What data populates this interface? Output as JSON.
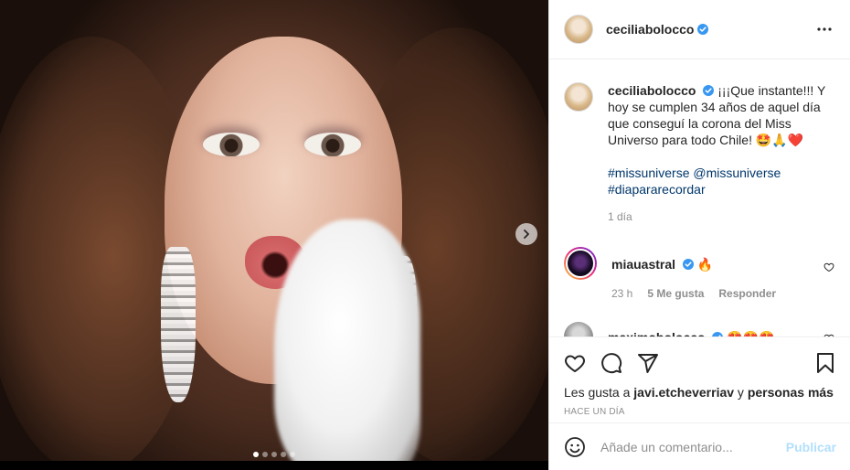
{
  "post": {
    "username": "ceciliabolocco",
    "caption": "¡¡¡Que instante!!! Y hoy se cumplen 34 años de aquel día que conseguí la corona del Miss Universo para todo Chile! 🤩🙏❤️",
    "hashtags": "#missuniverse @missuniverse #diapararecordar",
    "caption_time": "1 día"
  },
  "carousel": {
    "total": 5,
    "current": 1
  },
  "comments": [
    {
      "username": "miauastral",
      "text": "🔥",
      "time": "23 h",
      "likes": "5 Me gusta",
      "reply": "Responder"
    },
    {
      "username": "maximobolocco",
      "text": "😍😍😍"
    }
  ],
  "likes_line": {
    "prefix": "Les gusta a",
    "user": "javi.etcheverriav",
    "joiner": "y",
    "others": "personas más"
  },
  "posted_ago": "HACE UN DÍA",
  "composer": {
    "placeholder": "Añade un comentario...",
    "publish": "Publicar"
  },
  "colors": {
    "verified": "#3897f0",
    "publish_disabled": "#b2dffc",
    "link": "#00376b"
  }
}
